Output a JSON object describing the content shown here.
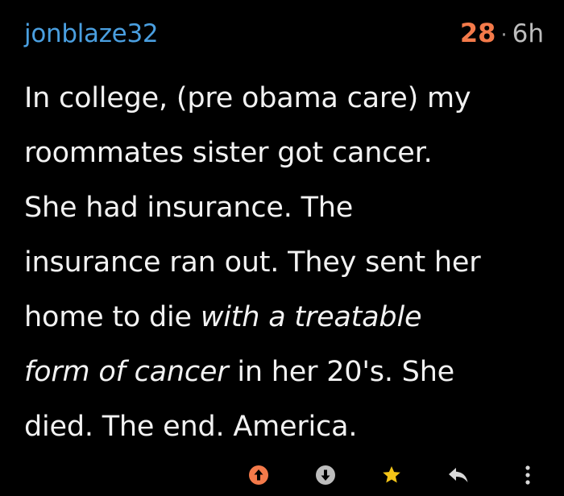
{
  "comment": {
    "username": "jonblaze32",
    "score": "28",
    "separator": "·",
    "time": "6h",
    "lines": [
      {
        "a": "In college, (pre obama care) my",
        "b": "",
        "c": ""
      },
      {
        "a": "roommates sister got cancer.",
        "b": "",
        "c": ""
      },
      {
        "a": "She had insurance. The",
        "b": "",
        "c": ""
      },
      {
        "a": "insurance ran out. They sent her",
        "b": "",
        "c": ""
      },
      {
        "a": "home to die ",
        "b": "with a treatable",
        "c": ""
      },
      {
        "a": "",
        "b": "form of cancer",
        "c": " in her 20's. She"
      },
      {
        "a": "died. The end. America.",
        "b": "",
        "c": ""
      }
    ]
  },
  "actions": {
    "upvote_icon": "arrow-up-circle",
    "downvote_icon": "arrow-down-circle",
    "save_icon": "star",
    "reply_icon": "reply-arrow",
    "more_icon": "vertical-ellipsis"
  },
  "colors": {
    "background": "#000000",
    "username": "#4a9fe0",
    "score": "#f47a4a",
    "upvote": "#f47a4a",
    "star": "#f5c518"
  }
}
